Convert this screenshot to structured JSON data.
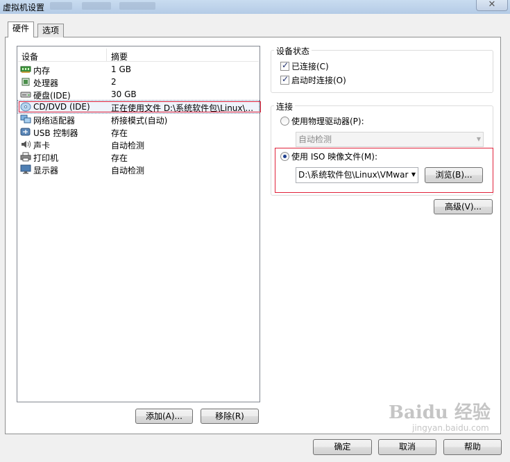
{
  "window": {
    "title": "虚拟机设置",
    "close_glyph": "✕"
  },
  "tabs": [
    {
      "label": "硬件"
    },
    {
      "label": "选项"
    }
  ],
  "device_list": {
    "col_device": "设备",
    "col_summary": "摘要",
    "rows": [
      {
        "name": "内存",
        "summary": "1 GB"
      },
      {
        "name": "处理器",
        "summary": "2"
      },
      {
        "name": "硬盘(IDE)",
        "summary": "30 GB"
      },
      {
        "name": "CD/DVD (IDE)",
        "summary": "正在使用文件 D:\\系统软件包\\Linux\\..."
      },
      {
        "name": "网络适配器",
        "summary": "桥接模式(自动)"
      },
      {
        "name": "USB 控制器",
        "summary": "存在"
      },
      {
        "name": "声卡",
        "summary": "自动检测"
      },
      {
        "name": "打印机",
        "summary": "存在"
      },
      {
        "name": "显示器",
        "summary": "自动检测"
      }
    ]
  },
  "device_status": {
    "title": "设备状态",
    "connected_label": "已连接(C)",
    "connect_on_power_label": "启动时连接(O)"
  },
  "connection": {
    "title": "连接",
    "physical_label": "使用物理驱动器(P):",
    "physical_value": "自动检测",
    "iso_label": "使用 ISO 映像文件(M):",
    "iso_value": "D:\\系统软件包\\Linux\\VMwar",
    "browse_label": "浏览(B)..."
  },
  "advanced_label": "高级(V)...",
  "add_label": "添加(A)...",
  "remove_label": "移除(R)",
  "ok_label": "确定",
  "cancel_label": "取消",
  "help_label": "帮助",
  "watermark": {
    "text": "Baidu 经验",
    "url": "jingyan.baidu.com"
  }
}
